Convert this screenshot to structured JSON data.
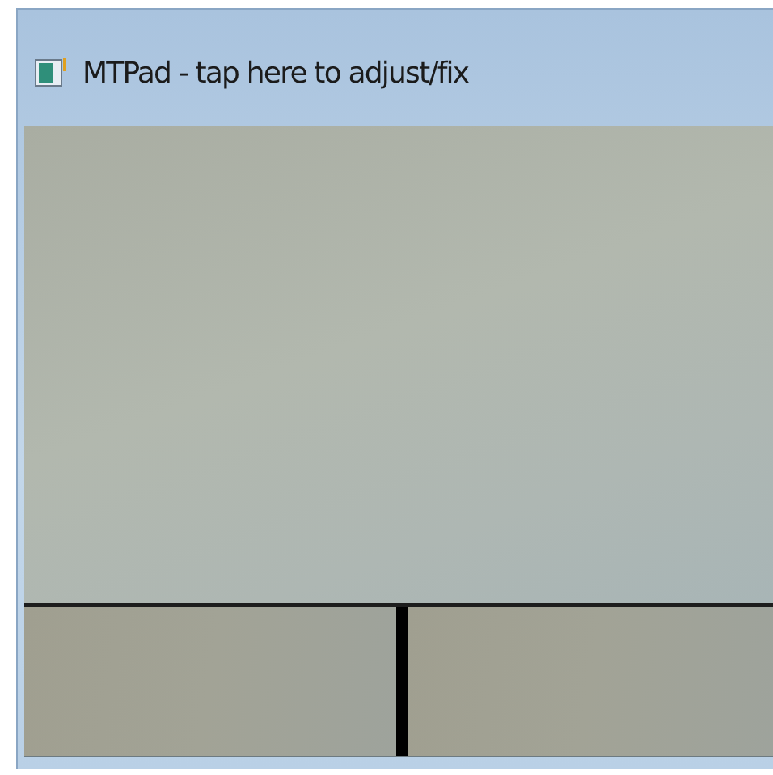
{
  "window": {
    "title": "MTPad - tap here to adjust/fix"
  }
}
